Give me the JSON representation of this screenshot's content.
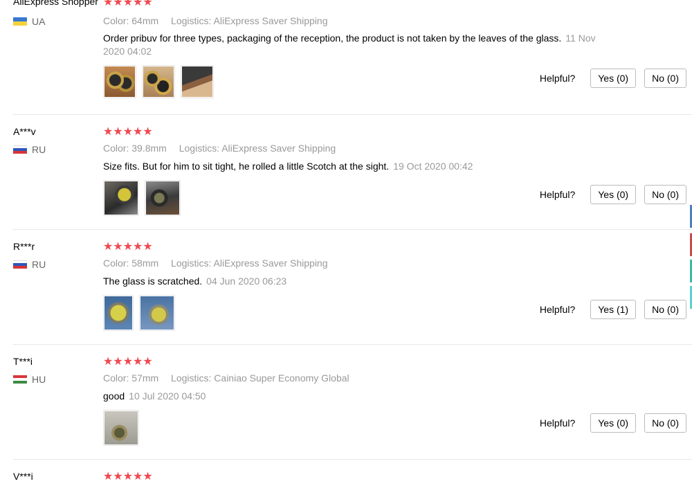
{
  "star_char": "★★★★★",
  "helpful_label": "Helpful?",
  "reviews": [
    {
      "name": "AliExpress Shopper",
      "country": "UA",
      "flag_colors": [
        "#3a78d0",
        "#f5d23b"
      ],
      "color_key": "Color:",
      "color_val": "64mm",
      "logistics_key": "Logistics:",
      "logistics_val": "AliExpress Saver Shipping",
      "content": "Order pribuv for three types, packaging of the reception, the product is not taken by the leaves of the glass.",
      "date": "11 Nov 2020 04:02",
      "photos": [
        "photo-lens-set",
        "photo-lens-pair",
        "photo-package-box"
      ],
      "yes": "Yes (0)",
      "no": "No (0)"
    },
    {
      "name": "A***v",
      "country": "RU",
      "flag_colors": [
        "#ffffff",
        "#2f57b8",
        "#d8343a"
      ],
      "color_key": "Color:",
      "color_val": "39.8mm",
      "logistics_key": "Logistics:",
      "logistics_val": "AliExpress Saver Shipping",
      "content": "Size fits. But for him to sit tight, he rolled a little Scotch at the sight.",
      "date": "19 Oct 2020 00:42",
      "photos": [
        "photo-scope-yellow",
        "photo-scope-rifle"
      ],
      "yes": "Yes (0)",
      "no": "No (0)"
    },
    {
      "name": "R***r",
      "country": "RU",
      "flag_colors": [
        "#ffffff",
        "#2f57b8",
        "#d8343a"
      ],
      "color_key": "Color:",
      "color_val": "58mm",
      "logistics_key": "Logistics:",
      "logistics_val": "AliExpress Saver Shipping",
      "content": "The glass is scratched.",
      "date": "04 Jun 2020 06:23",
      "photos": [
        "photo-yellow-glass-front",
        "photo-yellow-glass-angle"
      ],
      "yes": "Yes (1)",
      "no": "No (0)"
    },
    {
      "name": "T***i",
      "country": "HU",
      "flag_colors": [
        "#d8343a",
        "#ffffff",
        "#3d8b45"
      ],
      "color_key": "Color:",
      "color_val": "57mm",
      "logistics_key": "Logistics:",
      "logistics_val": "Cainiao Super Economy Global",
      "content": "good",
      "date": "10 Jul 2020 04:50",
      "photos": [
        "photo-lens-in-bag"
      ],
      "yes": "Yes (0)",
      "no": "No (0)"
    },
    {
      "name": "V***i",
      "country": "",
      "flag_colors": [],
      "color_key": "",
      "color_val": "",
      "logistics_key": "",
      "logistics_val": "",
      "content": "",
      "date": "",
      "photos": [],
      "yes": "",
      "no": ""
    }
  ],
  "accent_colors": [
    "#4a7fc0",
    "#c94a4a",
    "#3ab8a8",
    "#5ad1d1"
  ]
}
